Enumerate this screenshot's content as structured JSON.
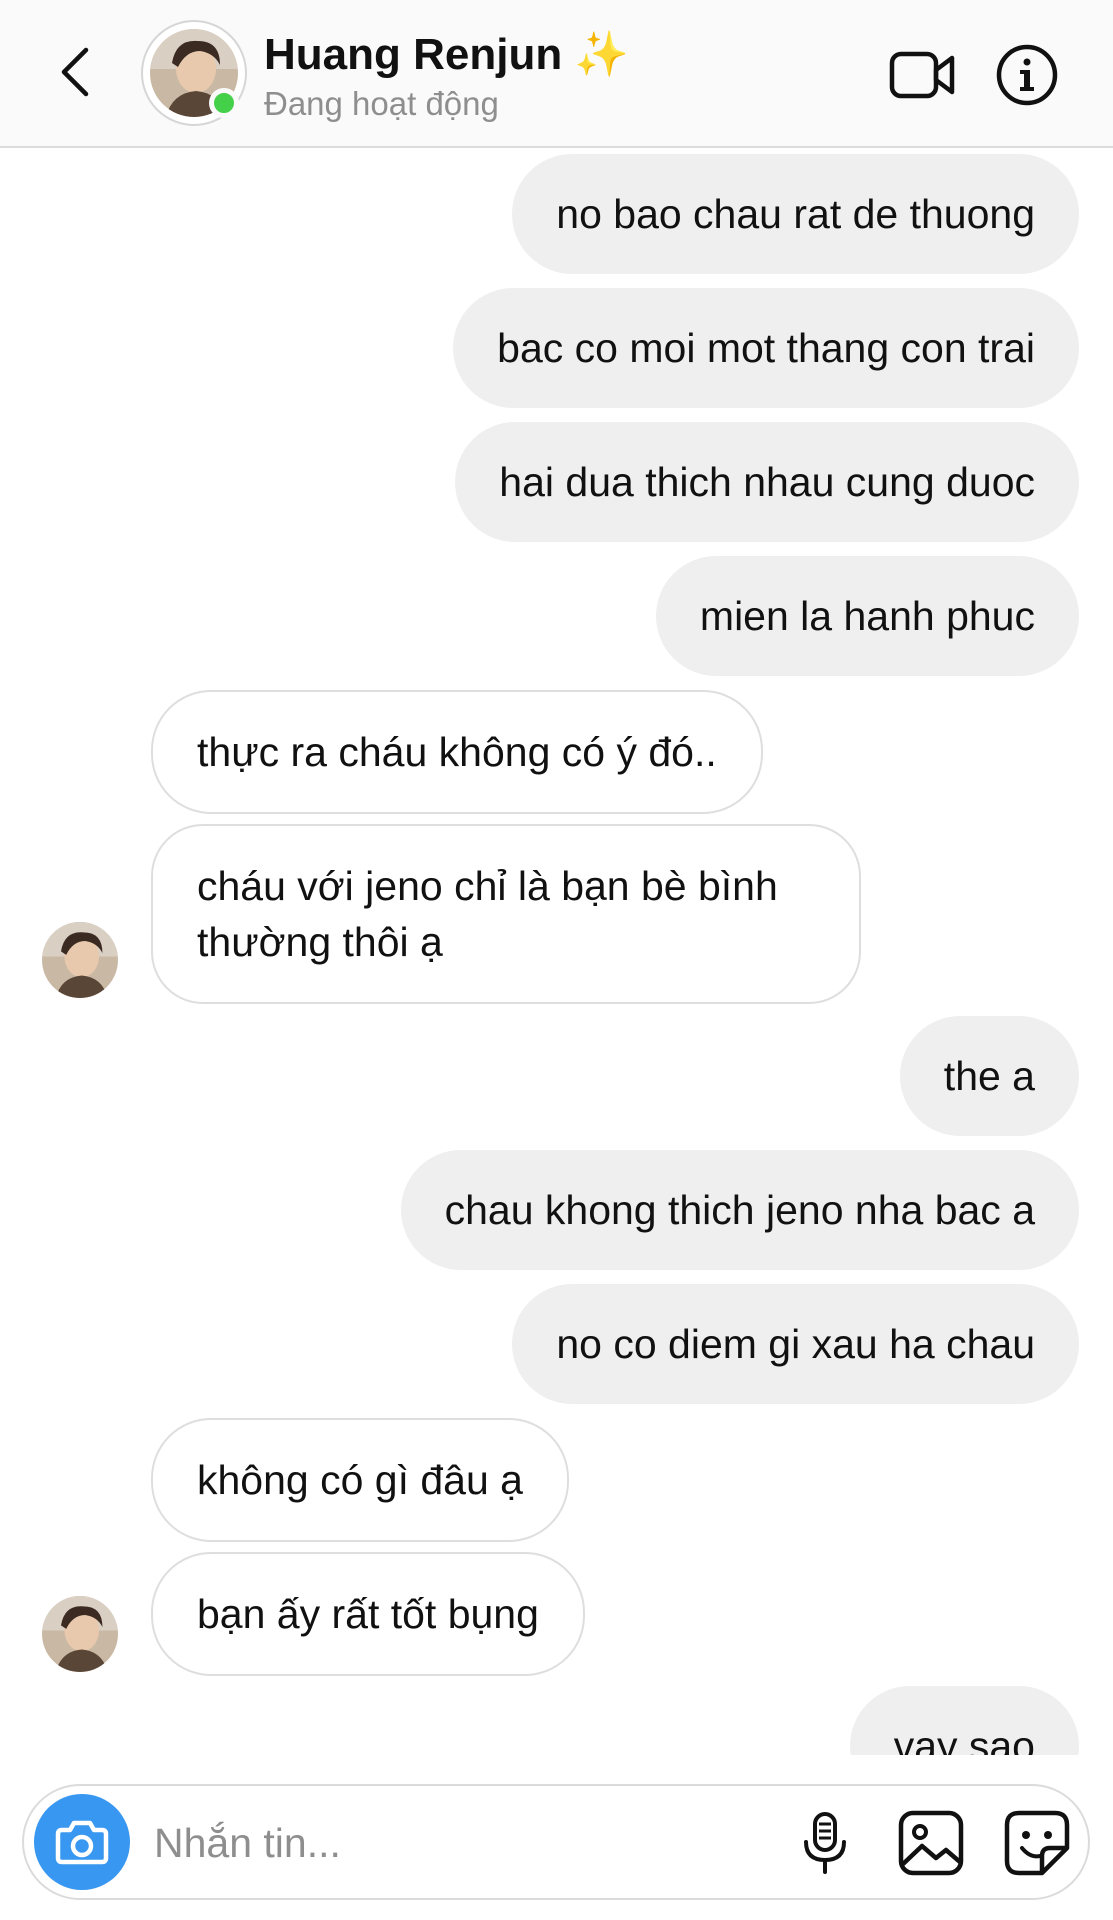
{
  "header": {
    "name": "Huang Renjun",
    "status": "Đang hoạt động",
    "sparkle": "✨"
  },
  "messages": [
    {
      "side": "sent",
      "text": "no bao chau rat de thuong"
    },
    {
      "side": "sent",
      "text": "bac co moi mot thang con trai"
    },
    {
      "side": "sent",
      "text": "hai dua thich nhau cung duoc"
    },
    {
      "side": "sent",
      "text": "mien la hanh phuc"
    },
    {
      "side": "received",
      "text": "thực ra cháu không có ý đó.."
    },
    {
      "side": "received",
      "text": "cháu với jeno chỉ là bạn bè bình thường thôi ạ"
    },
    {
      "side": "sent",
      "text": "the a"
    },
    {
      "side": "sent",
      "text": "chau khong thich jeno nha bac a"
    },
    {
      "side": "sent",
      "text": "no co diem gi xau ha chau"
    },
    {
      "side": "received",
      "text": "không có gì đâu ạ"
    },
    {
      "side": "received",
      "text": "bạn ấy rất tốt bụng"
    },
    {
      "side": "sent",
      "text": "vay sao"
    }
  ],
  "composer": {
    "placeholder": "Nhắn tin..."
  },
  "icons": {
    "back": "chevron-left-icon",
    "video": "video-camera-icon",
    "info": "info-icon",
    "camera": "camera-icon",
    "mic": "microphone-icon",
    "gallery": "image-icon",
    "sticker": "sticker-icon"
  },
  "colors": {
    "online": "#45d04a",
    "camera_button": "#3897f0",
    "sent_bubble": "#efefef",
    "sparkle": "#f5c542"
  }
}
